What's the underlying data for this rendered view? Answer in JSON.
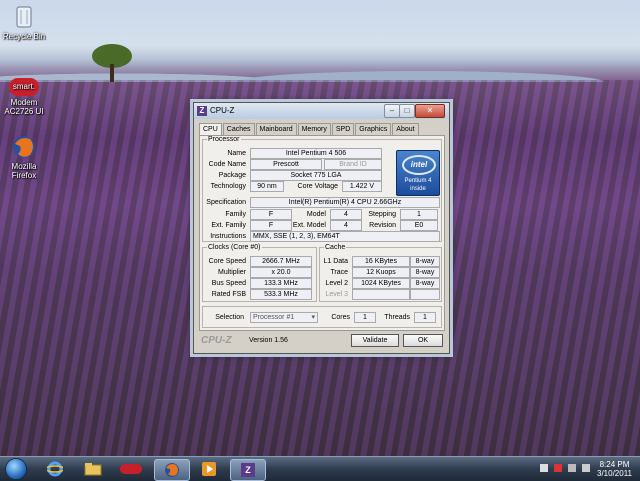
{
  "desktop": {
    "icons": [
      {
        "label": "Recycle Bin",
        "icon": "recycle-bin-icon"
      },
      {
        "label": "smart.",
        "caption1": "Modem",
        "caption2": "AC2726 UI",
        "icon": "smart-modem-icon"
      },
      {
        "label": "Mozilla",
        "caption2": "Firefox",
        "icon": "firefox-icon"
      }
    ]
  },
  "window": {
    "title": "CPU-Z",
    "tabs": [
      "CPU",
      "Caches",
      "Mainboard",
      "Memory",
      "SPD",
      "Graphics",
      "About"
    ],
    "selected_tab": "CPU",
    "processor": {
      "legend": "Processor",
      "name_label": "Name",
      "name": "Intel Pentium 4 506",
      "codename_label": "Code Name",
      "codename": "Prescott",
      "brandid_label": "Brand ID",
      "package_label": "Package",
      "package": "Socket 775 LGA",
      "technology_label": "Technology",
      "technology": "90 nm",
      "voltage_label": "Core Voltage",
      "voltage": "1.422 V",
      "spec_label": "Specification",
      "spec": "Intel(R) Pentium(R) 4 CPU 2.66GHz",
      "family_label": "Family",
      "family": "F",
      "model_label": "Model",
      "model": "4",
      "stepping_label": "Stepping",
      "stepping": "1",
      "extfamily_label": "Ext. Family",
      "extfamily": "F",
      "extmodel_label": "Ext. Model",
      "extmodel": "4",
      "revision_label": "Revision",
      "revision": "E0",
      "instructions_label": "Instructions",
      "instructions": "MMX, SSE (1, 2, 3), EM64T",
      "logo": {
        "brand": "intel",
        "line": "Pentium 4",
        "tag": "inside"
      }
    },
    "clocks": {
      "legend": "Clocks (Core #0)",
      "corespeed_label": "Core Speed",
      "corespeed": "2666.7 MHz",
      "multiplier_label": "Multiplier",
      "multiplier": "x 20.0",
      "busspeed_label": "Bus Speed",
      "busspeed": "133.3 MHz",
      "ratedfsb_label": "Rated FSB",
      "ratedfsb": "533.3 MHz"
    },
    "cache": {
      "legend": "Cache",
      "l1_label": "L1 Data",
      "l1": "16 KBytes",
      "l1_way": "8-way",
      "trace_label": "Trace",
      "trace": "12 Kuops",
      "trace_way": "8-way",
      "l2_label": "Level 2",
      "l2": "1024 KBytes",
      "l2_way": "8-way",
      "l3_label": "Level 3"
    },
    "selection_label": "Selection",
    "selection": "Processor #1",
    "cores_label": "Cores",
    "cores": "1",
    "threads_label": "Threads",
    "threads": "1",
    "footer_logo": "CPU-Z",
    "version": "Version 1.56",
    "validate_label": "Validate",
    "ok_label": "OK"
  },
  "taskbar": {
    "time": "8:24 PM",
    "date": "3/10/2011"
  }
}
